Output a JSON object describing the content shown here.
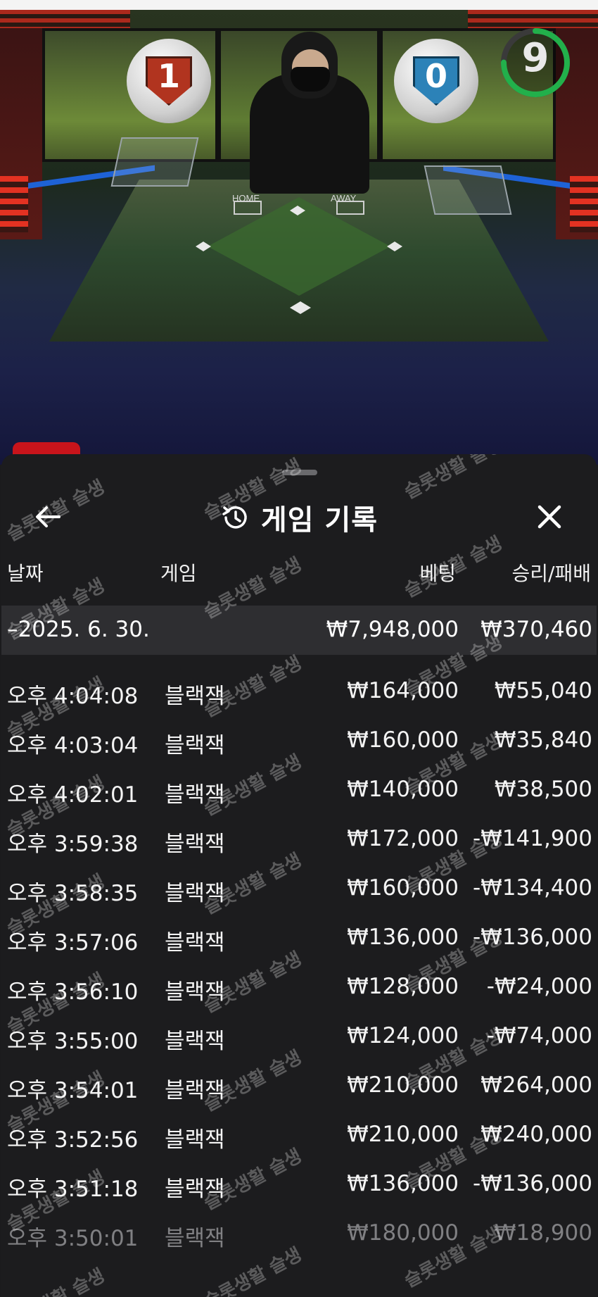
{
  "video": {
    "home_score": "1",
    "away_score": "0",
    "timer": "9",
    "timer_fraction": 0.75,
    "plate_home": "HOME",
    "plate_away": "AWAY",
    "colors": {
      "timer_ring": "#22b04b",
      "home": "#b1341f",
      "away": "#2c82b8"
    }
  },
  "sheet": {
    "title": "게임 기록",
    "icons": {
      "back": "arrow-left-icon",
      "history": "history-icon",
      "close": "close-icon"
    },
    "columns": {
      "date": "날짜",
      "game": "게임",
      "bet": "베팅",
      "result": "승리/패배"
    },
    "day_summary": {
      "date": "–2025. 6. 30.",
      "bet": "₩7,948,000",
      "result": "₩370,460"
    },
    "rows": [
      {
        "time": "오후 4:04:08",
        "game": "블랙잭",
        "bet": "₩164,000",
        "result": "₩55,040"
      },
      {
        "time": "오후 4:03:04",
        "game": "블랙잭",
        "bet": "₩160,000",
        "result": "₩35,840"
      },
      {
        "time": "오후 4:02:01",
        "game": "블랙잭",
        "bet": "₩140,000",
        "result": "₩38,500"
      },
      {
        "time": "오후 3:59:38",
        "game": "블랙잭",
        "bet": "₩172,000",
        "result": "-₩141,900"
      },
      {
        "time": "오후 3:58:35",
        "game": "블랙잭",
        "bet": "₩160,000",
        "result": "-₩134,400"
      },
      {
        "time": "오후 3:57:06",
        "game": "블랙잭",
        "bet": "₩136,000",
        "result": "-₩136,000"
      },
      {
        "time": "오후 3:56:10",
        "game": "블랙잭",
        "bet": "₩128,000",
        "result": "-₩24,000"
      },
      {
        "time": "오후 3:55:00",
        "game": "블랙잭",
        "bet": "₩124,000",
        "result": "-₩74,000"
      },
      {
        "time": "오후 3:54:01",
        "game": "블랙잭",
        "bet": "₩210,000",
        "result": "₩264,000"
      },
      {
        "time": "오후 3:52:56",
        "game": "블랙잭",
        "bet": "₩210,000",
        "result": "₩240,000"
      },
      {
        "time": "오후 3:51:18",
        "game": "블랙잭",
        "bet": "₩136,000",
        "result": "-₩136,000"
      },
      {
        "time": "오후 3:50:01",
        "game": "블랙잭",
        "bet": "₩180,000",
        "result": "₩18,900"
      }
    ]
  },
  "watermark": "슬롯생활 슬생"
}
